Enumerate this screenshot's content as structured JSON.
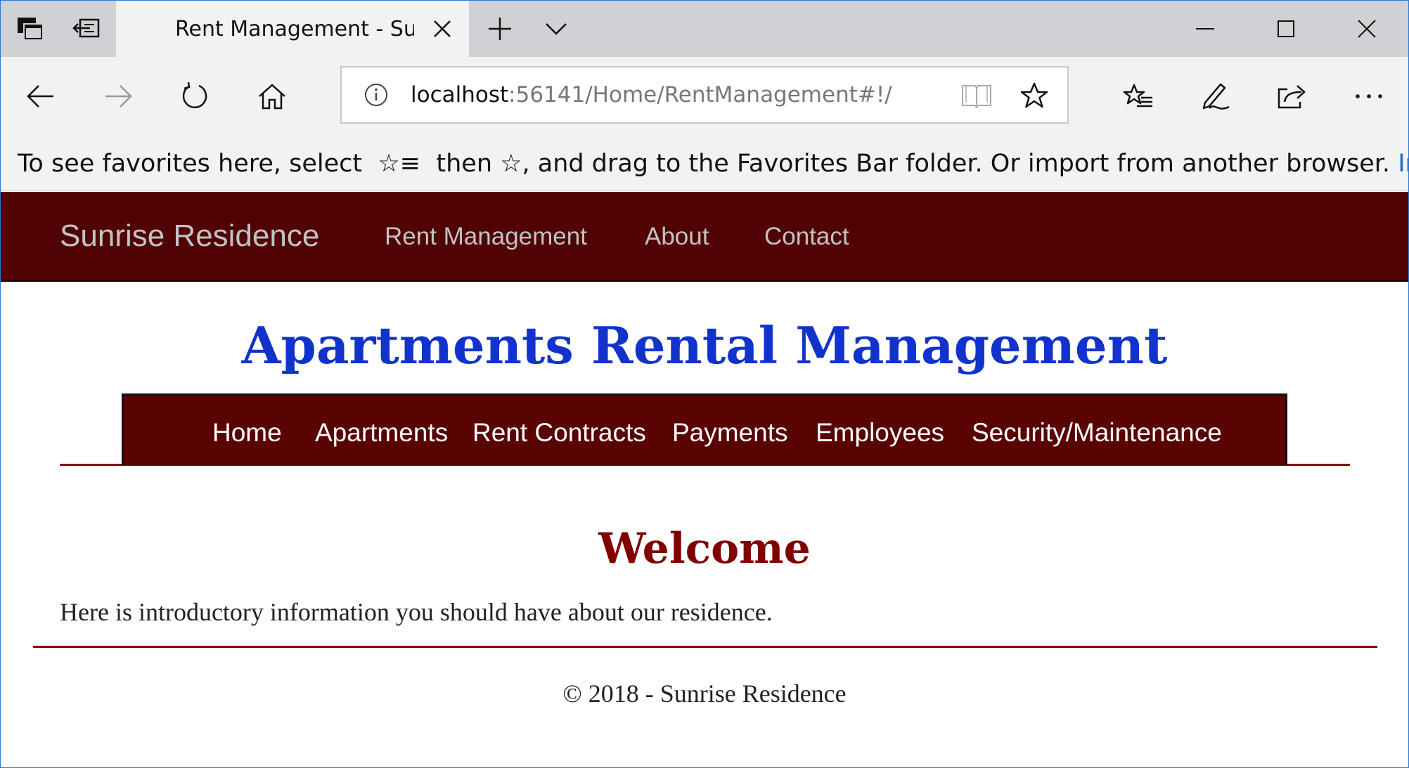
{
  "browser": {
    "tab_title": "Rent Management - Sunrise Residence",
    "url_host": "localhost",
    "url_rest": ":56141/Home/RentManagement#!/",
    "favorites_prefix": "To see favorites here, select",
    "favorites_middle": "then ☆, and drag to the Favorites Bar folder. Or import from another browser.",
    "favorites_link": "Import favorites",
    "icons": {
      "tab_preview": "tab-preview-icon",
      "set_aside": "set-aside-tabs-icon",
      "close_tab": "close-icon",
      "new_tab": "plus-icon",
      "tab_list": "chevron-down-icon",
      "minimize": "minimize-icon",
      "maximize": "maximize-icon",
      "close_window": "close-icon",
      "back": "back-arrow-icon",
      "forward": "forward-arrow-icon",
      "refresh": "refresh-icon",
      "home": "home-icon",
      "site_info": "info-icon",
      "reading_view": "reading-view-icon",
      "favorite": "star-icon",
      "favorites_hub": "favorites-list-icon",
      "web_note": "pen-icon",
      "share": "share-icon",
      "more": "more-icon"
    }
  },
  "site": {
    "brand": "Sunrise Residence",
    "nav": [
      "Rent Management",
      "About",
      "Contact"
    ],
    "title": "Apartments Rental Management",
    "menu": [
      "Home",
      "Apartments",
      "Rent Contracts",
      "Payments",
      "Employees",
      "Security/Maintenance"
    ],
    "welcome_heading": "Welcome",
    "intro": "Here is introductory information you should have about our residence.",
    "footer": "© 2018 - Sunrise Residence"
  },
  "colors": {
    "nav_background": "#500204",
    "menu_background": "#5a0303",
    "title": "#1133cc",
    "welcome": "#800000",
    "rule": "#8b0000",
    "link": "#1a6ec8"
  }
}
